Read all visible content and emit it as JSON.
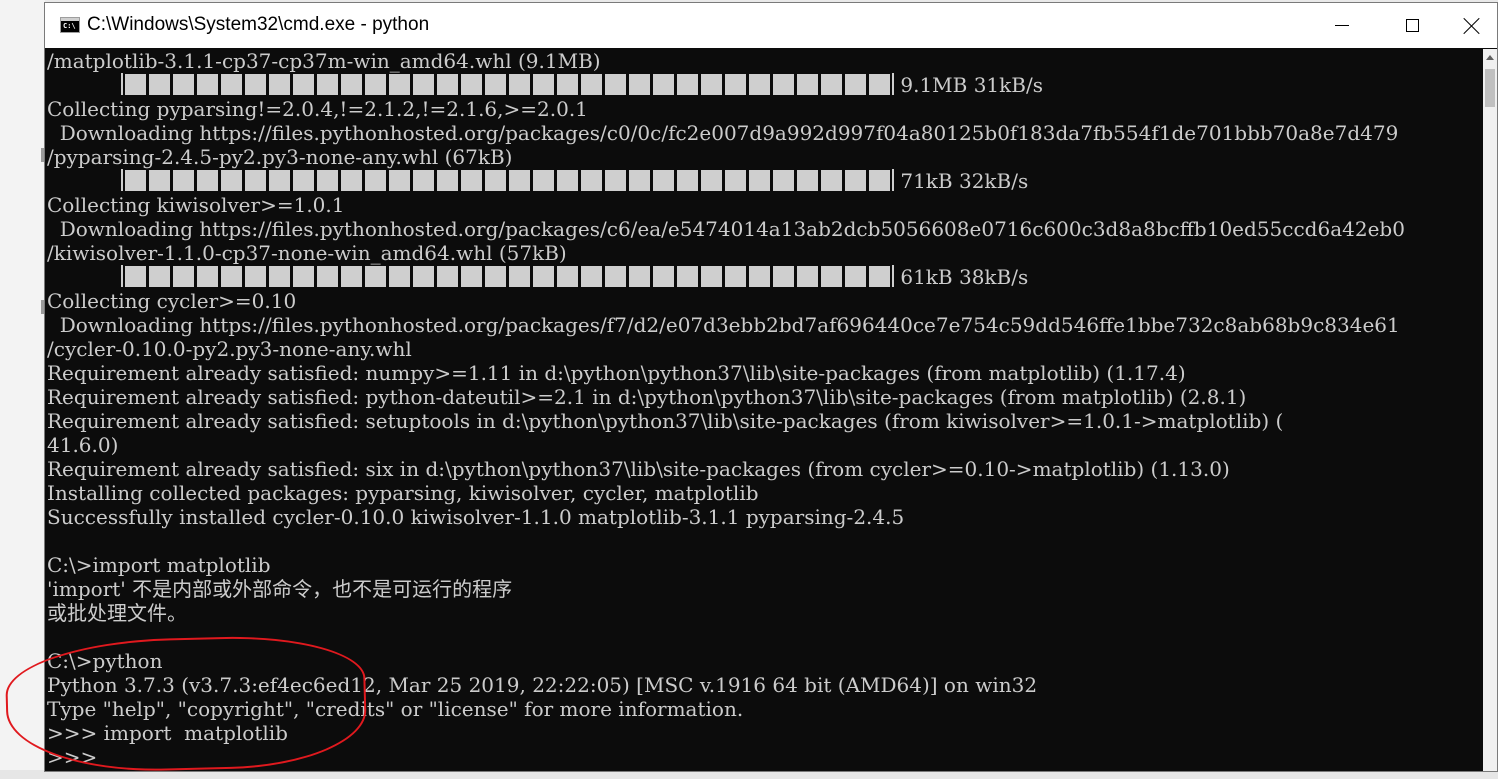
{
  "window": {
    "title": "C:\\Windows\\System32\\cmd.exe - python",
    "icon_label": "C:\\"
  },
  "console": {
    "lines": [
      {
        "text": "/matplotlib-3.1.1-cp37-cp37m-win_amd64.whl (9.1MB)"
      },
      {
        "progress": 1.0,
        "text": " 9.1MB 31kB/s"
      },
      {
        "text": "Collecting pyparsing!=2.0.4,!=2.1.2,!=2.1.6,>=2.0.1"
      },
      {
        "text": "  Downloading https://files.pythonhosted.org/packages/c0/0c/fc2e007d9a992d997f04a80125b0f183da7fb554f1de701bbb70a8e7d479"
      },
      {
        "text": "/pyparsing-2.4.5-py2.py3-none-any.whl (67kB)"
      },
      {
        "progress": 1.0,
        "text": " 71kB 32kB/s"
      },
      {
        "text": "Collecting kiwisolver>=1.0.1"
      },
      {
        "text": "  Downloading https://files.pythonhosted.org/packages/c6/ea/e5474014a13ab2dcb5056608e0716c600c3d8a8bcffb10ed55ccd6a42eb0"
      },
      {
        "text": "/kiwisolver-1.1.0-cp37-none-win_amd64.whl (57kB)"
      },
      {
        "progress": 1.0,
        "text": " 61kB 38kB/s"
      },
      {
        "text": "Collecting cycler>=0.10"
      },
      {
        "text": "  Downloading https://files.pythonhosted.org/packages/f7/d2/e07d3ebb2bd7af696440ce7e754c59dd546ffe1bbe732c8ab68b9c834e61"
      },
      {
        "text": "/cycler-0.10.0-py2.py3-none-any.whl"
      },
      {
        "text": "Requirement already satisfied: numpy>=1.11 in d:\\python\\python37\\lib\\site-packages (from matplotlib) (1.17.4)"
      },
      {
        "text": "Requirement already satisfied: python-dateutil>=2.1 in d:\\python\\python37\\lib\\site-packages (from matplotlib) (2.8.1)"
      },
      {
        "text": "Requirement already satisfied: setuptools in d:\\python\\python37\\lib\\site-packages (from kiwisolver>=1.0.1->matplotlib) ("
      },
      {
        "text": "41.6.0)"
      },
      {
        "text": "Requirement already satisfied: six in d:\\python\\python37\\lib\\site-packages (from cycler>=0.10->matplotlib) (1.13.0)"
      },
      {
        "text": "Installing collected packages: pyparsing, kiwisolver, cycler, matplotlib"
      },
      {
        "text": "Successfully installed cycler-0.10.0 kiwisolver-1.1.0 matplotlib-3.1.1 pyparsing-2.4.5"
      },
      {
        "text": ""
      },
      {
        "text": "C:\\>import matplotlib"
      },
      {
        "text": "'import' 不是内部或外部命令，也不是可运行的程序"
      },
      {
        "text": "或批处理文件。"
      },
      {
        "text": ""
      },
      {
        "text": "C:\\>python"
      },
      {
        "text": "Python 3.7.3 (v3.7.3:ef4ec6ed12, Mar 25 2019, 22:22:05) [MSC v.1916 64 bit (AMD64)] on win32"
      },
      {
        "text": "Type \"help\", \"copyright\", \"credits\" or \"license\" for more information."
      },
      {
        "text": ">>> import  matplotlib"
      },
      {
        "text": ">>>"
      }
    ]
  },
  "colors": {
    "console_background": "#0c0c0c",
    "console_text": "#cccccc",
    "annotation": "#e0191e"
  },
  "icons": {
    "minimize": "minimize-icon",
    "maximize": "maximize-icon",
    "close": "close-icon"
  }
}
